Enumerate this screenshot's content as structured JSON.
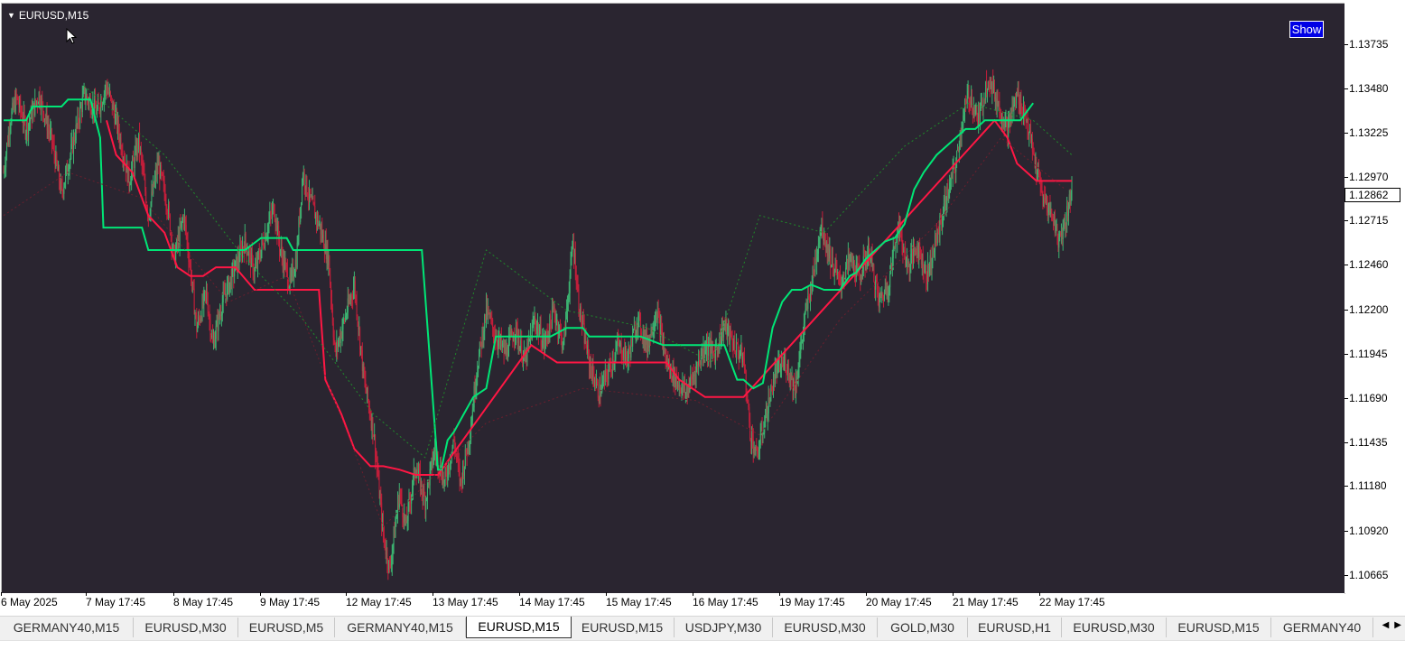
{
  "chart": {
    "symbol_label": "EURUSD,M15",
    "show_button": "Show",
    "current_price": "1.12862",
    "price_ticks": [
      "1.13735",
      "1.13480",
      "1.13225",
      "1.12970",
      "1.12715",
      "1.12460",
      "1.12200",
      "1.11945",
      "1.11690",
      "1.11435",
      "1.11180",
      "1.10920",
      "1.10665"
    ],
    "time_ticks": [
      "6 May 2025",
      "7 May 17:45",
      "8 May 17:45",
      "9 May 17:45",
      "12 May 17:45",
      "13 May 17:45",
      "14 May 17:45",
      "15 May 17:45",
      "16 May 17:45",
      "19 May 17:45",
      "20 May 17:45",
      "21 May 17:45",
      "22 May 17:45"
    ]
  },
  "colors": {
    "background": "#2a2530",
    "bull_candle": "#3cb371",
    "bear_candle": "#c41e3a",
    "support_line": "#00e676",
    "resistance_line": "#ff1744",
    "dotted_trend": "#1f8a2a",
    "button": "#0000e6"
  },
  "tabs": [
    {
      "label": "GERMANY40,M15",
      "active": false
    },
    {
      "label": "EURUSD,M30",
      "active": false
    },
    {
      "label": "EURUSD,M5",
      "active": false
    },
    {
      "label": "GERMANY40,M15",
      "active": false
    },
    {
      "label": "EURUSD,M15",
      "active": true
    },
    {
      "label": "EURUSD,M15",
      "active": false
    },
    {
      "label": "USDJPY,M30",
      "active": false
    },
    {
      "label": "EURUSD,M30",
      "active": false
    },
    {
      "label": "GOLD,M30",
      "active": false
    },
    {
      "label": "EURUSD,H1",
      "active": false
    },
    {
      "label": "EURUSD,M30",
      "active": false
    },
    {
      "label": "EURUSD,M15",
      "active": false
    },
    {
      "label": "GERMANY40",
      "active": false
    }
  ],
  "tab_scroll": {
    "left": "◀",
    "right": "▶"
  },
  "series_path": [
    [
      0,
      1.13
    ],
    [
      4,
      1.133
    ],
    [
      8,
      1.1343
    ],
    [
      14,
      1.1325
    ],
    [
      22,
      1.1345
    ],
    [
      30,
      1.1318
    ],
    [
      36,
      1.1288
    ],
    [
      42,
      1.1312
    ],
    [
      50,
      1.1345
    ],
    [
      58,
      1.1335
    ],
    [
      64,
      1.135
    ],
    [
      70,
      1.133
    ],
    [
      78,
      1.1295
    ],
    [
      84,
      1.1318
    ],
    [
      90,
      1.1275
    ],
    [
      96,
      1.1305
    ],
    [
      102,
      1.128
    ],
    [
      106,
      1.125
    ],
    [
      112,
      1.1275
    ],
    [
      116,
      1.1245
    ],
    [
      120,
      1.121
    ],
    [
      126,
      1.123
    ],
    [
      130,
      1.12
    ],
    [
      136,
      1.1225
    ],
    [
      144,
      1.1245
    ],
    [
      150,
      1.126
    ],
    [
      156,
      1.1242
    ],
    [
      162,
      1.1262
    ],
    [
      168,
      1.128
    ],
    [
      172,
      1.1255
    ],
    [
      178,
      1.1235
    ],
    [
      182,
      1.125
    ],
    [
      186,
      1.13
    ],
    [
      190,
      1.1285
    ],
    [
      196,
      1.127
    ],
    [
      202,
      1.125
    ],
    [
      206,
      1.1195
    ],
    [
      212,
      1.1215
    ],
    [
      218,
      1.1235
    ],
    [
      224,
      1.118
    ],
    [
      230,
      1.115
    ],
    [
      236,
      1.109
    ],
    [
      240,
      1.107
    ],
    [
      246,
      1.1115
    ],
    [
      250,
      1.1095
    ],
    [
      256,
      1.113
    ],
    [
      262,
      1.111
    ],
    [
      268,
      1.114
    ],
    [
      274,
      1.112
    ],
    [
      280,
      1.1145
    ],
    [
      284,
      1.112
    ],
    [
      290,
      1.115
    ],
    [
      294,
      1.1185
    ],
    [
      300,
      1.122
    ],
    [
      306,
      1.1205
    ],
    [
      312,
      1.1195
    ],
    [
      318,
      1.121
    ],
    [
      324,
      1.119
    ],
    [
      330,
      1.1215
    ],
    [
      336,
      1.12
    ],
    [
      342,
      1.122
    ],
    [
      348,
      1.12
    ],
    [
      354,
      1.126
    ],
    [
      358,
      1.122
    ],
    [
      364,
      1.119
    ],
    [
      370,
      1.1172
    ],
    [
      376,
      1.1185
    ],
    [
      382,
      1.12
    ],
    [
      388,
      1.1192
    ],
    [
      394,
      1.1215
    ],
    [
      400,
      1.12
    ],
    [
      406,
      1.122
    ],
    [
      412,
      1.119
    ],
    [
      418,
      1.118
    ],
    [
      424,
      1.1172
    ],
    [
      430,
      1.1185
    ],
    [
      436,
      1.12
    ],
    [
      442,
      1.1195
    ],
    [
      448,
      1.1212
    ],
    [
      454,
      1.12
    ],
    [
      460,
      1.1192
    ],
    [
      464,
      1.115
    ],
    [
      468,
      1.1135
    ],
    [
      474,
      1.116
    ],
    [
      480,
      1.1185
    ],
    [
      486,
      1.119
    ],
    [
      492,
      1.1175
    ],
    [
      498,
      1.1215
    ],
    [
      504,
      1.1245
    ],
    [
      508,
      1.127
    ],
    [
      514,
      1.125
    ],
    [
      520,
      1.1235
    ],
    [
      526,
      1.125
    ],
    [
      532,
      1.124
    ],
    [
      538,
      1.1255
    ],
    [
      544,
      1.1225
    ],
    [
      550,
      1.1235
    ],
    [
      556,
      1.127
    ],
    [
      562,
      1.1245
    ],
    [
      568,
      1.1258
    ],
    [
      574,
      1.124
    ],
    [
      580,
      1.1262
    ],
    [
      586,
      1.1285
    ],
    [
      592,
      1.1305
    ],
    [
      596,
      1.133
    ],
    [
      600,
      1.1345
    ],
    [
      606,
      1.133
    ],
    [
      612,
      1.1355
    ],
    [
      618,
      1.134
    ],
    [
      624,
      1.1325
    ],
    [
      630,
      1.1345
    ],
    [
      636,
      1.133
    ],
    [
      640,
      1.131
    ],
    [
      646,
      1.1285
    ],
    [
      652,
      1.1275
    ],
    [
      656,
      1.126
    ],
    [
      660,
      1.1272
    ],
    [
      664,
      1.129
    ]
  ],
  "support_line": [
    [
      0,
      1.133
    ],
    [
      14,
      1.133
    ],
    [
      18,
      1.1338
    ],
    [
      36,
      1.1338
    ],
    [
      40,
      1.1342
    ],
    [
      54,
      1.1342
    ],
    [
      60,
      1.132
    ],
    [
      62,
      1.1268
    ],
    [
      70,
      1.1268
    ],
    [
      80,
      1.1268
    ],
    [
      86,
      1.1268
    ],
    [
      90,
      1.1255
    ],
    [
      150,
      1.1255
    ],
    [
      160,
      1.1262
    ],
    [
      176,
      1.1262
    ],
    [
      180,
      1.1255
    ],
    [
      210,
      1.1255
    ],
    [
      230,
      1.1255
    ],
    [
      260,
      1.1255
    ],
    [
      270,
      1.1128
    ],
    [
      272,
      1.1128
    ],
    [
      276,
      1.1145
    ],
    [
      280,
      1.115
    ],
    [
      286,
      1.116
    ],
    [
      292,
      1.117
    ],
    [
      300,
      1.1175
    ],
    [
      306,
      1.1205
    ],
    [
      314,
      1.1205
    ],
    [
      320,
      1.1205
    ],
    [
      330,
      1.1205
    ],
    [
      340,
      1.1205
    ],
    [
      350,
      1.121
    ],
    [
      360,
      1.121
    ],
    [
      364,
      1.1205
    ],
    [
      372,
      1.1205
    ],
    [
      378,
      1.1205
    ],
    [
      386,
      1.1205
    ],
    [
      396,
      1.1205
    ],
    [
      410,
      1.12
    ],
    [
      418,
      1.12
    ],
    [
      422,
      1.12
    ],
    [
      430,
      1.12
    ],
    [
      438,
      1.12
    ],
    [
      442,
      1.12
    ],
    [
      448,
      1.12
    ],
    [
      456,
      1.118
    ],
    [
      460,
      1.118
    ],
    [
      466,
      1.1175
    ],
    [
      472,
      1.1178
    ],
    [
      478,
      1.121
    ],
    [
      484,
      1.1225
    ],
    [
      490,
      1.1232
    ],
    [
      496,
      1.1232
    ],
    [
      502,
      1.1235
    ],
    [
      510,
      1.1232
    ],
    [
      516,
      1.1232
    ],
    [
      520,
      1.1232
    ],
    [
      526,
      1.124
    ],
    [
      530,
      1.1242
    ],
    [
      536,
      1.125
    ],
    [
      542,
      1.1255
    ],
    [
      548,
      1.126
    ],
    [
      554,
      1.1262
    ],
    [
      560,
      1.127
    ],
    [
      566,
      1.129
    ],
    [
      572,
      1.13
    ],
    [
      580,
      1.131
    ],
    [
      586,
      1.1315
    ],
    [
      592,
      1.132
    ],
    [
      598,
      1.1325
    ],
    [
      604,
      1.1325
    ],
    [
      610,
      1.133
    ],
    [
      620,
      1.133
    ],
    [
      626,
      1.133
    ],
    [
      632,
      1.133
    ],
    [
      640,
      1.134
    ]
  ],
  "resistance_line": [
    [
      64,
      1.133
    ],
    [
      70,
      1.131
    ],
    [
      80,
      1.13
    ],
    [
      86,
      1.1285
    ],
    [
      90,
      1.1275
    ],
    [
      100,
      1.1265
    ],
    [
      108,
      1.1245
    ],
    [
      116,
      1.124
    ],
    [
      124,
      1.124
    ],
    [
      132,
      1.1245
    ],
    [
      144,
      1.1245
    ],
    [
      156,
      1.1232
    ],
    [
      164,
      1.1232
    ],
    [
      172,
      1.1232
    ],
    [
      180,
      1.1232
    ],
    [
      186,
      1.1232
    ],
    [
      192,
      1.1232
    ],
    [
      196,
      1.1232
    ],
    [
      200,
      1.118
    ],
    [
      210,
      1.116
    ],
    [
      218,
      1.114
    ],
    [
      228,
      1.113
    ],
    [
      236,
      1.113
    ],
    [
      246,
      1.1128
    ],
    [
      256,
      1.1125
    ],
    [
      262,
      1.1125
    ],
    [
      266,
      1.1125
    ],
    [
      270,
      1.1125
    ],
    [
      328,
      1.12
    ],
    [
      336,
      1.1195
    ],
    [
      344,
      1.119
    ],
    [
      352,
      1.119
    ],
    [
      362,
      1.119
    ],
    [
      372,
      1.119
    ],
    [
      380,
      1.119
    ],
    [
      388,
      1.119
    ],
    [
      396,
      1.119
    ],
    [
      404,
      1.119
    ],
    [
      412,
      1.119
    ],
    [
      420,
      1.118
    ],
    [
      428,
      1.1175
    ],
    [
      436,
      1.117
    ],
    [
      444,
      1.117
    ],
    [
      452,
      1.117
    ],
    [
      460,
      1.117
    ],
    [
      616,
      1.133
    ],
    [
      624,
      1.132
    ],
    [
      630,
      1.1305
    ],
    [
      636,
      1.13
    ],
    [
      642,
      1.1295
    ],
    [
      648,
      1.1295
    ],
    [
      656,
      1.1295
    ],
    [
      664,
      1.1295
    ]
  ]
}
